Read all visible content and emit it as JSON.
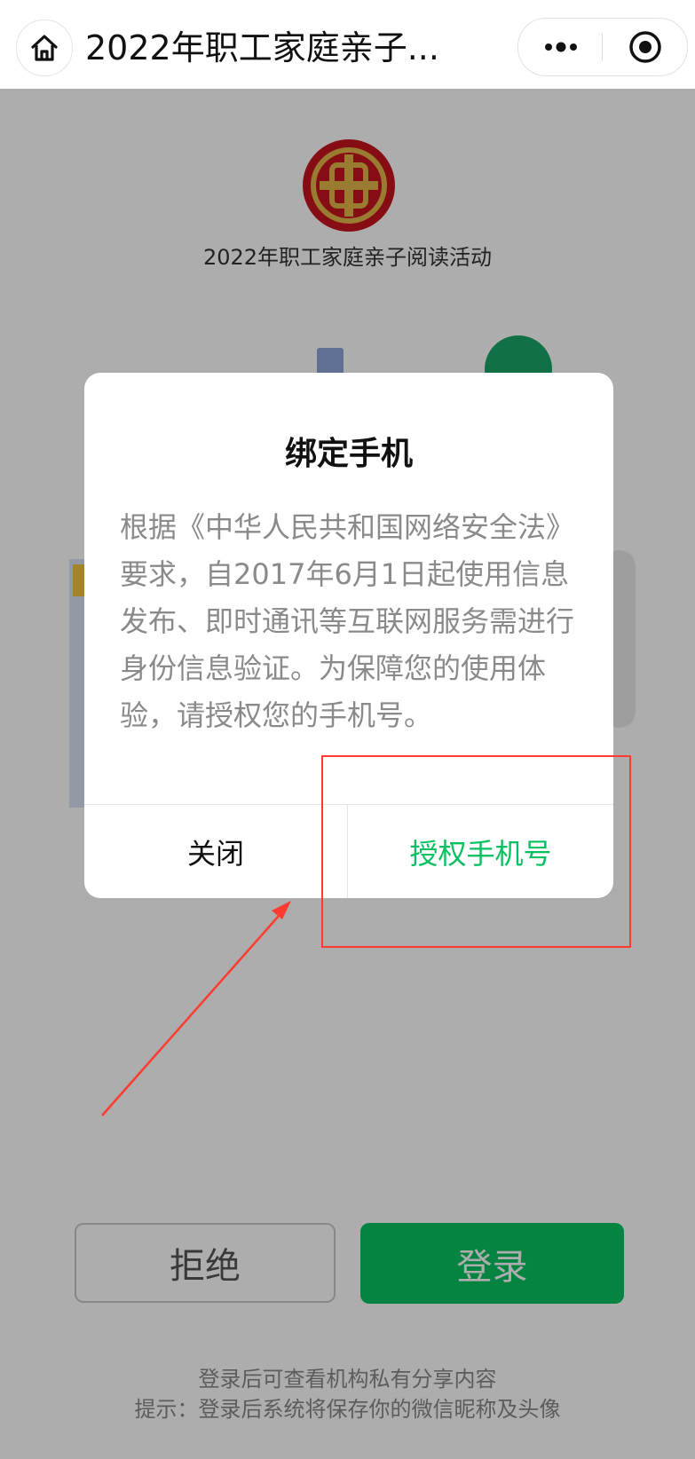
{
  "topbar": {
    "title": "2022年职工家庭亲子...",
    "home_icon": "home-icon",
    "more_icon": "more-icon",
    "close_icon": "record-icon"
  },
  "page": {
    "activity_title": "2022年职工家庭亲子阅读活动",
    "reject_label": "拒绝",
    "login_label": "登录",
    "hint_line1": "登录后可查看机构私有分享内容",
    "hint_line2": "提示：登录后系统将保存你的微信昵称及头像"
  },
  "dialog": {
    "title": "绑定手机",
    "body": "根据《中华人民共和国网络安全法》要求，自2017年6月1日起使用信息发布、即时通讯等互联网服务需进行身份信息验证。为保障您的使用体验，请授权您的手机号。",
    "close_label": "关闭",
    "authorize_label": "授权手机号"
  },
  "colors": {
    "accent_green": "#07c160",
    "annotation_red": "#ff3b30"
  }
}
